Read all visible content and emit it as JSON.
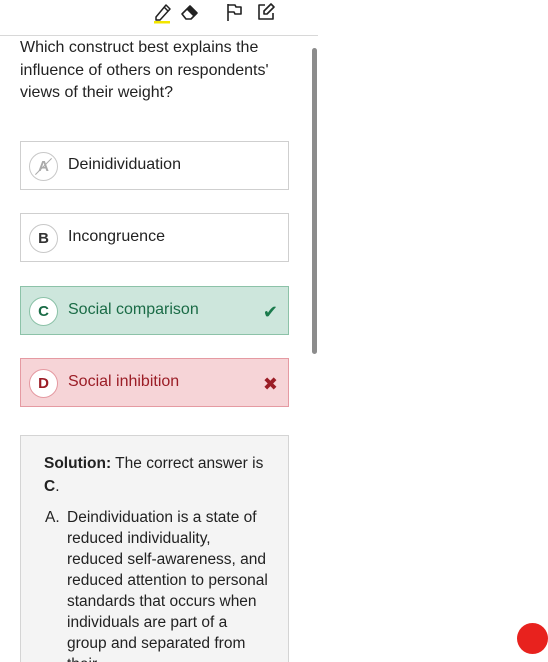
{
  "question": {
    "text": "Which construct best explains the influence of others on respondents' views of their weight?"
  },
  "toolbar": {
    "icons": [
      "highlighter-icon",
      "eraser-icon",
      "flag-icon",
      "edit-note-icon"
    ],
    "highlight_color": "#f3e600"
  },
  "choices": [
    {
      "letter": "A",
      "label": "Deinidividuation",
      "state": "struck"
    },
    {
      "letter": "B",
      "label": "Incongruence",
      "state": "default"
    },
    {
      "letter": "C",
      "label": "Social comparison",
      "state": "correct",
      "mark": "✔"
    },
    {
      "letter": "D",
      "label": "Social inhibition",
      "state": "wrong",
      "mark": "✖"
    }
  ],
  "solution": {
    "heading_bold": "Solution:",
    "heading_text": " The correct answer is ",
    "answer": "C",
    "answer_suffix": ".",
    "items": [
      {
        "letter": "A.",
        "text": "Deindividuation is a state of reduced individuality, reduced self-awareness, and reduced attention to personal standards that occurs when individuals are part of a group and separated from their"
      }
    ]
  },
  "colors": {
    "correct_bg": "#cde6dc",
    "correct_text": "#1a6b46",
    "wrong_bg": "#f6d4d7",
    "wrong_text": "#9b1d26",
    "record_dot": "#e8221e"
  }
}
